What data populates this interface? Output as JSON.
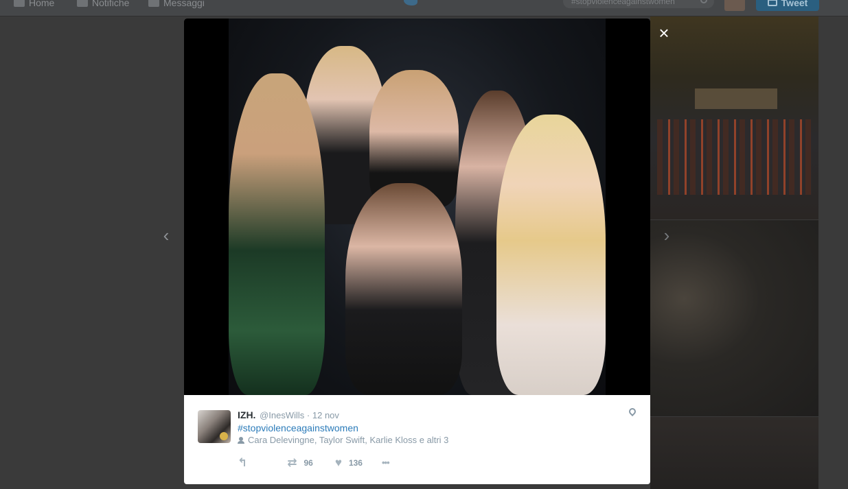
{
  "topbar": {
    "home_label": "Home",
    "notifications_label": "Notifiche",
    "messages_label": "Messaggi",
    "search_value": "#stopviolenceagainstwomen",
    "tweet_button_label": "Tweet"
  },
  "modal": {
    "close_glyph": "×",
    "prev_glyph": "‹",
    "next_glyph": "›"
  },
  "tweet": {
    "name": "IZH.",
    "handle": "@InesWills",
    "separator": "·",
    "date": "12 nov",
    "hashtag": "#stopviolenceagainstwomen",
    "tagged_people": "Cara Delevingne, Taylor Swift, Karlie Kloss e altri 3",
    "actions": {
      "reply_glyph": "↰",
      "retweet_glyph": "⇄",
      "retweet_count": "96",
      "like_glyph": "♥",
      "like_count": "136",
      "more_glyph": "•••"
    }
  },
  "colors": {
    "link": "#2b7bb9",
    "secondary_text": "#8899a6",
    "primary_text": "#292f33"
  }
}
